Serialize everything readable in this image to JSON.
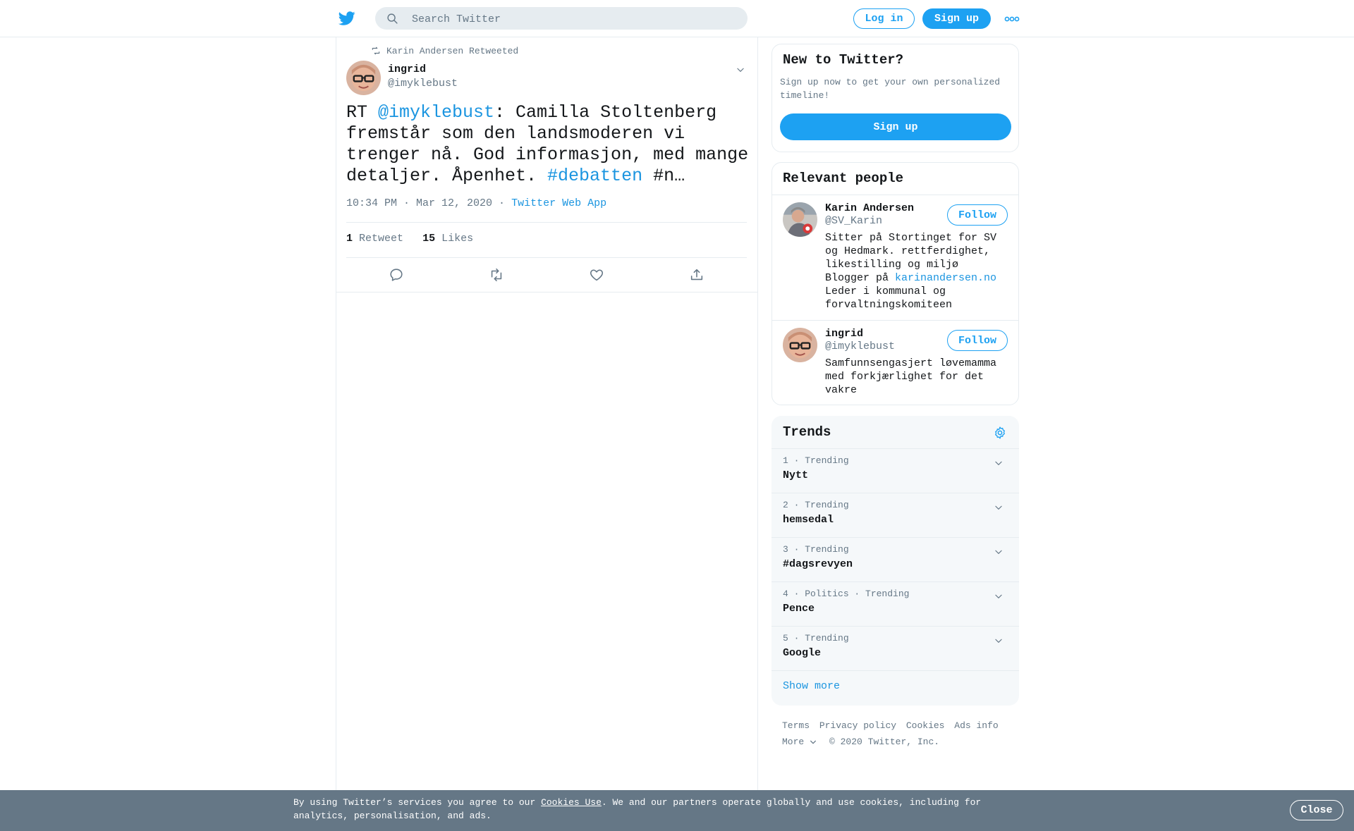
{
  "header": {
    "search_placeholder": "Search Twitter",
    "login_label": "Log in",
    "signup_label": "Sign up"
  },
  "tweet": {
    "retweet_context": "Karin Andersen Retweeted",
    "author_name": "ingrid",
    "author_handle": "@imyklebust",
    "text_prefix": "RT ",
    "text_mention": "@imyklebust",
    "text_body": ": Camilla Stoltenberg fremstår som den landsmoderen vi trenger nå. God informasjon, med mange detaljer. Åpenhet. ",
    "text_hashtag": "#debatten",
    "text_suffix": " #n…",
    "timestamp": "10:34 PM · Mar 12, 2020",
    "source_sep": " · ",
    "source": "Twitter Web App",
    "retweet_count": "1",
    "retweet_label": "Retweet",
    "like_count": "15",
    "like_label": "Likes"
  },
  "sidebar": {
    "new_title": "New to Twitter?",
    "new_desc": "Sign up now to get your own personalized timeline!",
    "new_signup": "Sign up",
    "relevant_title": "Relevant people",
    "people": [
      {
        "name": "Karin Andersen",
        "handle": "@SV_Karin",
        "follow": "Follow",
        "bio_line1": "Sitter på Stortinget for SV og Hedmark. rettferdighet, likestilling og miljø",
        "bio_blog": "Blogger på ",
        "bio_link": "karinandersen.no",
        "bio_line3": "Leder i kommunal og forvaltningskomiteen"
      },
      {
        "name": "ingrid",
        "handle": "@imyklebust",
        "follow": "Follow",
        "bio": "Samfunnsengasjert løvemamma med forkjærlighet for det vakre"
      }
    ],
    "trends_title": "Trends",
    "trends": [
      {
        "meta": "1 · Trending",
        "name": "Nytt"
      },
      {
        "meta": "2 · Trending",
        "name": "hemsedal"
      },
      {
        "meta": "3 · Trending",
        "name": "#dagsrevyen"
      },
      {
        "meta": "4 · Politics · Trending",
        "name": "Pence"
      },
      {
        "meta": "5 · Trending",
        "name": "Google"
      }
    ],
    "show_more": "Show more",
    "footer": {
      "terms": "Terms",
      "privacy": "Privacy policy",
      "cookies": "Cookies",
      "ads": "Ads info",
      "more": "More",
      "copyright": "© 2020 Twitter, Inc."
    }
  },
  "cookie": {
    "text_before": "By using Twitter’s services you agree to our ",
    "link": "Cookies Use",
    "text_after": ". We and our partners operate globally and use cookies, including for analytics, personalisation, and ads.",
    "close": "Close"
  },
  "colors": {
    "brand": "#1da1f2",
    "link": "#1b95e0",
    "muted": "#657786",
    "border": "#e6ecf0",
    "trend_bg": "#f5f8fa"
  }
}
